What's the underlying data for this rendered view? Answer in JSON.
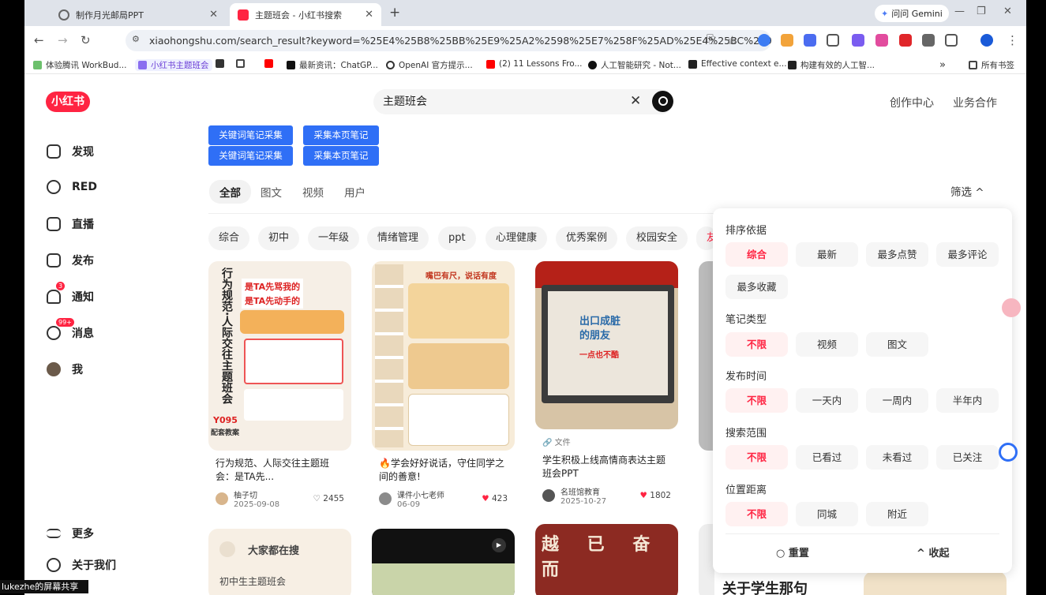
{
  "browser": {
    "tabs": [
      {
        "label": "制作月光邮局PPT"
      },
      {
        "label": "主题班会 - 小红书搜索"
      }
    ],
    "gemini_label": "问问 Gemini",
    "url": "xiaohongshu.com/search_result?keyword=%25E4%25B8%25BB%25E9%25A2%2598%25E7%258F%25AD%25E4%25BC%259A&s...",
    "bookmarks": [
      "体验腾讯 WorkBud...",
      "小红书主题班会",
      "最新资讯：ChatGP...",
      "OpenAI 官方提示...",
      "(2) 11 Lessons Fro...",
      "人工智能研究 - Not...",
      "Effective context e...",
      "构建有效的人工智...",
      "所有书签"
    ],
    "more_bookmarks": "»"
  },
  "site": {
    "logo": "小红书",
    "search_value": "主题班会",
    "top_links": [
      "创作中心",
      "业务合作"
    ],
    "nav": [
      {
        "label": "发现",
        "icon": "home-icon"
      },
      {
        "label": "RED",
        "icon": "play-icon"
      },
      {
        "label": "直播",
        "icon": "live-icon"
      },
      {
        "label": "发布",
        "icon": "plus-icon"
      },
      {
        "label": "通知",
        "icon": "bell-icon",
        "badge": "3"
      },
      {
        "label": "消息",
        "icon": "message-icon",
        "badge": "99+"
      },
      {
        "label": "我",
        "icon": "avatar"
      }
    ],
    "nav_bottom": [
      "更多",
      "关于我们"
    ],
    "collect_buttons": [
      "关键词笔记采集",
      "采集本页笔记",
      "关键词笔记采集",
      "采集本页笔记"
    ],
    "tabs": [
      "全部",
      "图文",
      "视频",
      "用户"
    ],
    "filter_label": "筛选",
    "chips": [
      "综合",
      "初中",
      "一年级",
      "情绪管理",
      "ppt",
      "心理健康",
      "优秀案例",
      "校园安全",
      "友"
    ]
  },
  "cards": [
    {
      "title": "行为规范、人际交往主题班会：是TA先...",
      "author": "柚子切",
      "date": "2025-09-08",
      "likes": "2455",
      "liked": false,
      "poster_lines": [
        "行为规范·人际交往主题班会",
        "是TA先骂我的",
        "是TA先动手的",
        "Y095",
        "配套教案"
      ]
    },
    {
      "title": "🔥学会好好说话，守住同学之间的善意!",
      "author": "课件小七老师",
      "date": "06-09",
      "likes": "423",
      "liked": true,
      "poster_lines": [
        "嘴巴有尺，说话有度"
      ]
    },
    {
      "title": "学生积极上线高情商表达主题班会PPT",
      "author": "名班馆教育",
      "date": "2025-10-27",
      "likes": "1802",
      "liked": true,
      "tag": "文件",
      "poster_lines": [
        "出口成脏的朋友",
        "一点也不酷"
      ]
    }
  ],
  "bottom_row": {
    "search_title": "大家都在搜",
    "search_item": "初中生主题班会",
    "banner_text": "越 已 奋 而",
    "big_text": "关于学生那句"
  },
  "filter_panel": {
    "groups": [
      {
        "title": "排序依据",
        "options": [
          "综合",
          "最新",
          "最多点赞",
          "最多评论",
          "最多收藏"
        ],
        "selected": "综合"
      },
      {
        "title": "笔记类型",
        "options": [
          "不限",
          "视频",
          "图文"
        ],
        "selected": "不限"
      },
      {
        "title": "发布时间",
        "options": [
          "不限",
          "一天内",
          "一周内",
          "半年内"
        ],
        "selected": "不限"
      },
      {
        "title": "搜索范围",
        "options": [
          "不限",
          "已看过",
          "未看过",
          "已关注"
        ],
        "selected": "不限"
      },
      {
        "title": "位置距离",
        "options": [
          "不限",
          "同城",
          "附近"
        ],
        "selected": "不限"
      }
    ],
    "reset": "重置",
    "collapse": "收起"
  },
  "share_label": "lukezhe的屏幕共享",
  "colors": {
    "brand": "#ff2442",
    "collect_blue": "#2f6ff6"
  }
}
